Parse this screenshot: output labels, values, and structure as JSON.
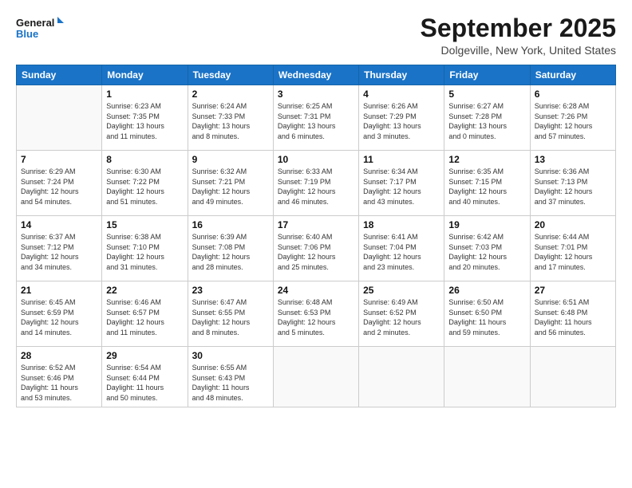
{
  "logo": {
    "line1": "General",
    "line2": "Blue"
  },
  "title": "September 2025",
  "location": "Dolgeville, New York, United States",
  "days_of_week": [
    "Sunday",
    "Monday",
    "Tuesday",
    "Wednesday",
    "Thursday",
    "Friday",
    "Saturday"
  ],
  "weeks": [
    [
      {
        "day": "",
        "info": ""
      },
      {
        "day": "1",
        "info": "Sunrise: 6:23 AM\nSunset: 7:35 PM\nDaylight: 13 hours\nand 11 minutes."
      },
      {
        "day": "2",
        "info": "Sunrise: 6:24 AM\nSunset: 7:33 PM\nDaylight: 13 hours\nand 8 minutes."
      },
      {
        "day": "3",
        "info": "Sunrise: 6:25 AM\nSunset: 7:31 PM\nDaylight: 13 hours\nand 6 minutes."
      },
      {
        "day": "4",
        "info": "Sunrise: 6:26 AM\nSunset: 7:29 PM\nDaylight: 13 hours\nand 3 minutes."
      },
      {
        "day": "5",
        "info": "Sunrise: 6:27 AM\nSunset: 7:28 PM\nDaylight: 13 hours\nand 0 minutes."
      },
      {
        "day": "6",
        "info": "Sunrise: 6:28 AM\nSunset: 7:26 PM\nDaylight: 12 hours\nand 57 minutes."
      }
    ],
    [
      {
        "day": "7",
        "info": "Sunrise: 6:29 AM\nSunset: 7:24 PM\nDaylight: 12 hours\nand 54 minutes."
      },
      {
        "day": "8",
        "info": "Sunrise: 6:30 AM\nSunset: 7:22 PM\nDaylight: 12 hours\nand 51 minutes."
      },
      {
        "day": "9",
        "info": "Sunrise: 6:32 AM\nSunset: 7:21 PM\nDaylight: 12 hours\nand 49 minutes."
      },
      {
        "day": "10",
        "info": "Sunrise: 6:33 AM\nSunset: 7:19 PM\nDaylight: 12 hours\nand 46 minutes."
      },
      {
        "day": "11",
        "info": "Sunrise: 6:34 AM\nSunset: 7:17 PM\nDaylight: 12 hours\nand 43 minutes."
      },
      {
        "day": "12",
        "info": "Sunrise: 6:35 AM\nSunset: 7:15 PM\nDaylight: 12 hours\nand 40 minutes."
      },
      {
        "day": "13",
        "info": "Sunrise: 6:36 AM\nSunset: 7:13 PM\nDaylight: 12 hours\nand 37 minutes."
      }
    ],
    [
      {
        "day": "14",
        "info": "Sunrise: 6:37 AM\nSunset: 7:12 PM\nDaylight: 12 hours\nand 34 minutes."
      },
      {
        "day": "15",
        "info": "Sunrise: 6:38 AM\nSunset: 7:10 PM\nDaylight: 12 hours\nand 31 minutes."
      },
      {
        "day": "16",
        "info": "Sunrise: 6:39 AM\nSunset: 7:08 PM\nDaylight: 12 hours\nand 28 minutes."
      },
      {
        "day": "17",
        "info": "Sunrise: 6:40 AM\nSunset: 7:06 PM\nDaylight: 12 hours\nand 25 minutes."
      },
      {
        "day": "18",
        "info": "Sunrise: 6:41 AM\nSunset: 7:04 PM\nDaylight: 12 hours\nand 23 minutes."
      },
      {
        "day": "19",
        "info": "Sunrise: 6:42 AM\nSunset: 7:03 PM\nDaylight: 12 hours\nand 20 minutes."
      },
      {
        "day": "20",
        "info": "Sunrise: 6:44 AM\nSunset: 7:01 PM\nDaylight: 12 hours\nand 17 minutes."
      }
    ],
    [
      {
        "day": "21",
        "info": "Sunrise: 6:45 AM\nSunset: 6:59 PM\nDaylight: 12 hours\nand 14 minutes."
      },
      {
        "day": "22",
        "info": "Sunrise: 6:46 AM\nSunset: 6:57 PM\nDaylight: 12 hours\nand 11 minutes."
      },
      {
        "day": "23",
        "info": "Sunrise: 6:47 AM\nSunset: 6:55 PM\nDaylight: 12 hours\nand 8 minutes."
      },
      {
        "day": "24",
        "info": "Sunrise: 6:48 AM\nSunset: 6:53 PM\nDaylight: 12 hours\nand 5 minutes."
      },
      {
        "day": "25",
        "info": "Sunrise: 6:49 AM\nSunset: 6:52 PM\nDaylight: 12 hours\nand 2 minutes."
      },
      {
        "day": "26",
        "info": "Sunrise: 6:50 AM\nSunset: 6:50 PM\nDaylight: 11 hours\nand 59 minutes."
      },
      {
        "day": "27",
        "info": "Sunrise: 6:51 AM\nSunset: 6:48 PM\nDaylight: 11 hours\nand 56 minutes."
      }
    ],
    [
      {
        "day": "28",
        "info": "Sunrise: 6:52 AM\nSunset: 6:46 PM\nDaylight: 11 hours\nand 53 minutes."
      },
      {
        "day": "29",
        "info": "Sunrise: 6:54 AM\nSunset: 6:44 PM\nDaylight: 11 hours\nand 50 minutes."
      },
      {
        "day": "30",
        "info": "Sunrise: 6:55 AM\nSunset: 6:43 PM\nDaylight: 11 hours\nand 48 minutes."
      },
      {
        "day": "",
        "info": ""
      },
      {
        "day": "",
        "info": ""
      },
      {
        "day": "",
        "info": ""
      },
      {
        "day": "",
        "info": ""
      }
    ]
  ]
}
